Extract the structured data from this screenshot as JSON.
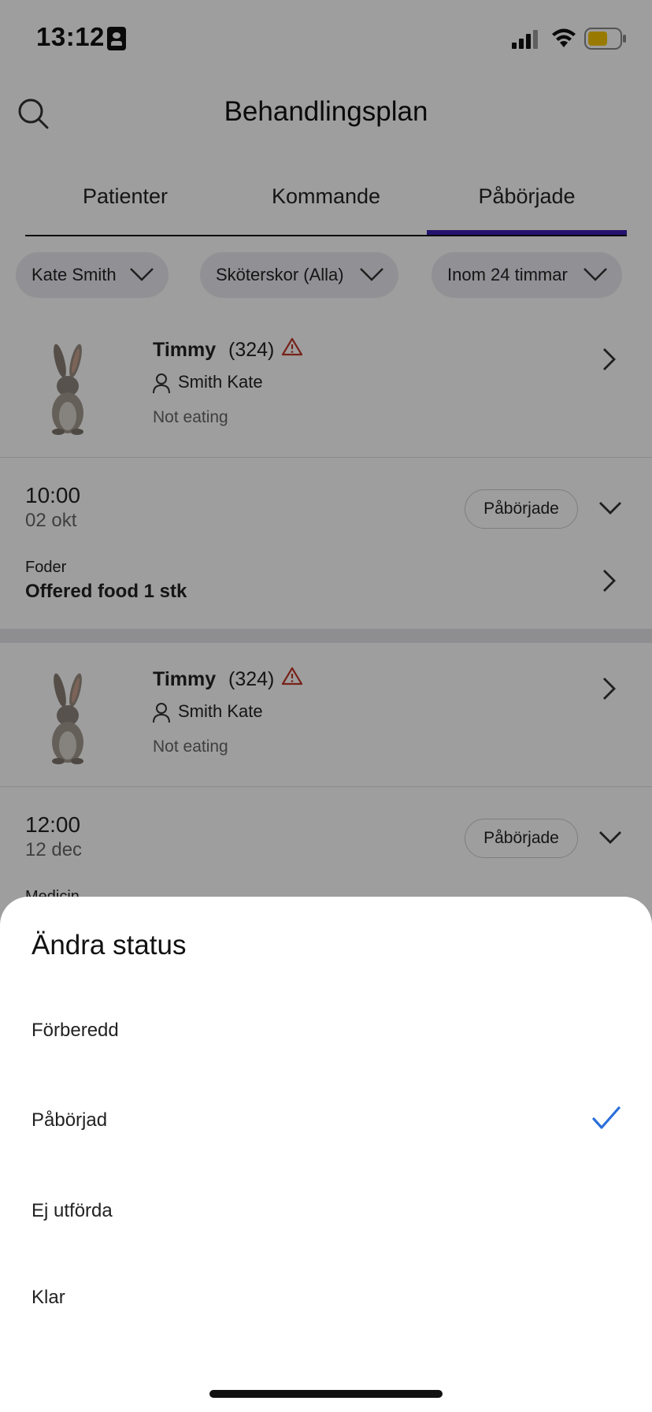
{
  "status_bar": {
    "time": "13:12",
    "battery_color": "#f7c600"
  },
  "header": {
    "title": "Behandlingsplan"
  },
  "tabs": [
    {
      "label": "Patienter",
      "active": false
    },
    {
      "label": "Kommande",
      "active": false
    },
    {
      "label": "Påbörjade",
      "active": true
    }
  ],
  "filters": [
    {
      "label": "Kate Smith"
    },
    {
      "label": "Sköterskor (Alla)"
    },
    {
      "label": "Inom 24 timmar"
    }
  ],
  "entries": [
    {
      "patient": {
        "name": "Timmy",
        "id": "(324)",
        "owner": "Smith Kate",
        "complaint": "Not eating"
      },
      "task": {
        "time": "10:00",
        "date": "02 okt",
        "status": "Påbörjade",
        "category": "Foder",
        "description": "Offered food 1 stk"
      }
    },
    {
      "patient": {
        "name": "Timmy",
        "id": "(324)",
        "owner": "Smith Kate",
        "complaint": "Not eating"
      },
      "task": {
        "time": "12:00",
        "date": "12 dec",
        "status": "Påbörjade",
        "category": "Medicin",
        "description": ""
      }
    }
  ],
  "sheet": {
    "title": "Ändra status",
    "options": [
      {
        "label": "Förberedd",
        "selected": false
      },
      {
        "label": "Påbörjad",
        "selected": true
      },
      {
        "label": "Ej utförda",
        "selected": false
      },
      {
        "label": "Klar",
        "selected": false
      }
    ]
  },
  "colors": {
    "accent": "#3a1fb0",
    "check": "#2a6fdb",
    "warning": "#c0392b"
  }
}
